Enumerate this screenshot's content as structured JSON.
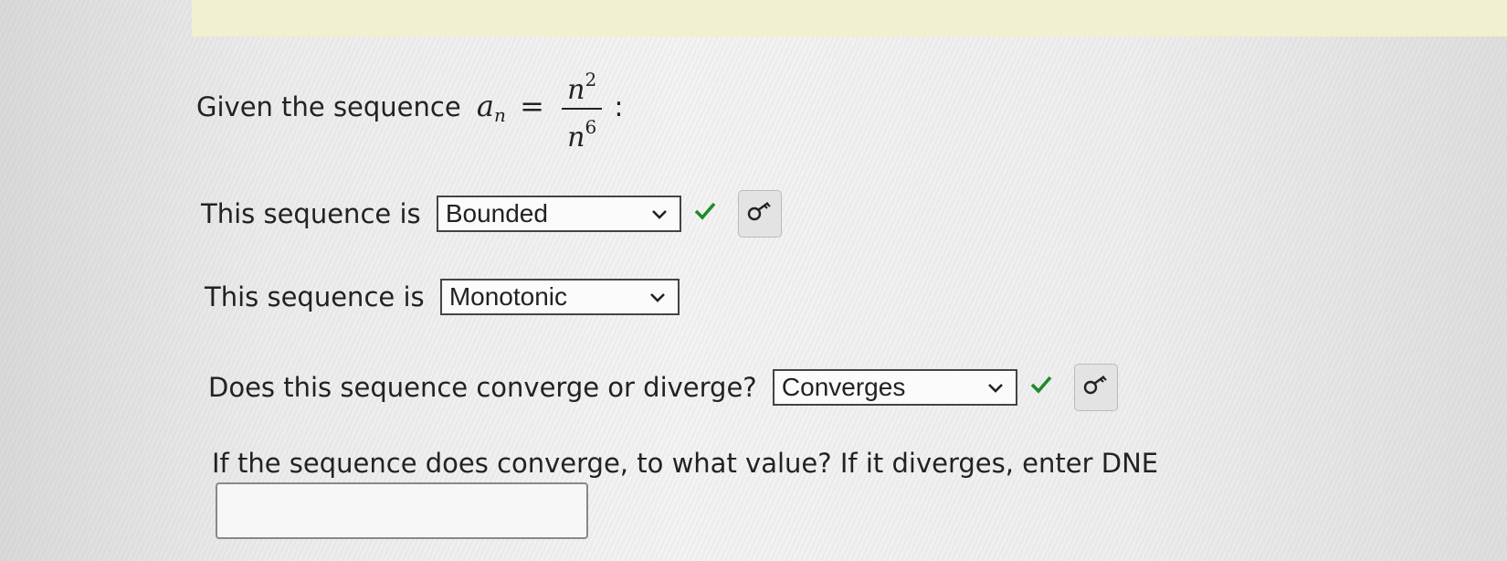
{
  "question": {
    "intro": "Given the sequence",
    "sequence_name": "a",
    "sequence_subscript": "n",
    "equals": "=",
    "numerator_base": "n",
    "numerator_exp": "2",
    "denominator_base": "n",
    "denominator_exp": "6",
    "trailing": ":"
  },
  "q1": {
    "label": "This sequence is",
    "selected": "Bounded",
    "status": "correct"
  },
  "q2": {
    "label": "This sequence is",
    "selected": "Monotonic"
  },
  "q3": {
    "label": "Does this sequence converge or diverge?",
    "selected": "Converges",
    "status": "correct"
  },
  "q4": {
    "label": "If the sequence does converge, to what value? If it diverges, enter DNE",
    "value": ""
  },
  "icons": {
    "dropdown": "chevron-down-icon",
    "correct": "check-icon",
    "key": "key-icon"
  },
  "colors": {
    "correct": "#1f8a2b",
    "banner": "#f1f0cf"
  }
}
